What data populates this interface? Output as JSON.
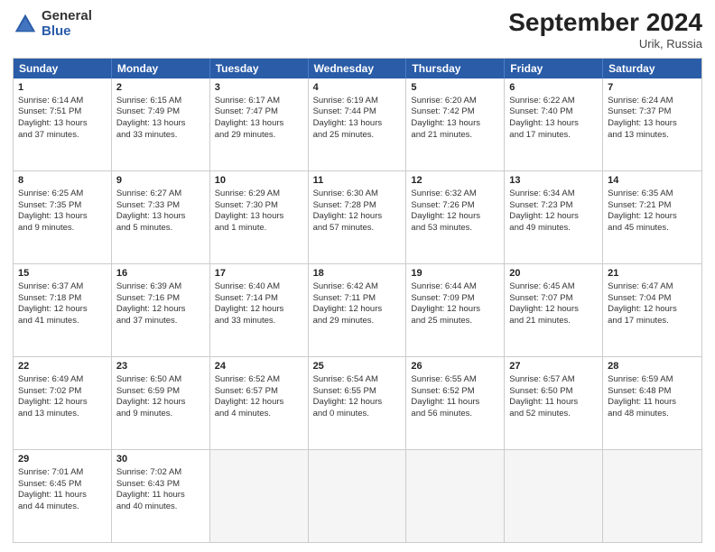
{
  "logo": {
    "general": "General",
    "blue": "Blue"
  },
  "title": "September 2024",
  "location": "Urik, Russia",
  "header_days": [
    "Sunday",
    "Monday",
    "Tuesday",
    "Wednesday",
    "Thursday",
    "Friday",
    "Saturday"
  ],
  "rows": [
    [
      {
        "day": "1",
        "lines": [
          "Sunrise: 6:14 AM",
          "Sunset: 7:51 PM",
          "Daylight: 13 hours",
          "and 37 minutes."
        ]
      },
      {
        "day": "2",
        "lines": [
          "Sunrise: 6:15 AM",
          "Sunset: 7:49 PM",
          "Daylight: 13 hours",
          "and 33 minutes."
        ]
      },
      {
        "day": "3",
        "lines": [
          "Sunrise: 6:17 AM",
          "Sunset: 7:47 PM",
          "Daylight: 13 hours",
          "and 29 minutes."
        ]
      },
      {
        "day": "4",
        "lines": [
          "Sunrise: 6:19 AM",
          "Sunset: 7:44 PM",
          "Daylight: 13 hours",
          "and 25 minutes."
        ]
      },
      {
        "day": "5",
        "lines": [
          "Sunrise: 6:20 AM",
          "Sunset: 7:42 PM",
          "Daylight: 13 hours",
          "and 21 minutes."
        ]
      },
      {
        "day": "6",
        "lines": [
          "Sunrise: 6:22 AM",
          "Sunset: 7:40 PM",
          "Daylight: 13 hours",
          "and 17 minutes."
        ]
      },
      {
        "day": "7",
        "lines": [
          "Sunrise: 6:24 AM",
          "Sunset: 7:37 PM",
          "Daylight: 13 hours",
          "and 13 minutes."
        ]
      }
    ],
    [
      {
        "day": "8",
        "lines": [
          "Sunrise: 6:25 AM",
          "Sunset: 7:35 PM",
          "Daylight: 13 hours",
          "and 9 minutes."
        ]
      },
      {
        "day": "9",
        "lines": [
          "Sunrise: 6:27 AM",
          "Sunset: 7:33 PM",
          "Daylight: 13 hours",
          "and 5 minutes."
        ]
      },
      {
        "day": "10",
        "lines": [
          "Sunrise: 6:29 AM",
          "Sunset: 7:30 PM",
          "Daylight: 13 hours",
          "and 1 minute."
        ]
      },
      {
        "day": "11",
        "lines": [
          "Sunrise: 6:30 AM",
          "Sunset: 7:28 PM",
          "Daylight: 12 hours",
          "and 57 minutes."
        ]
      },
      {
        "day": "12",
        "lines": [
          "Sunrise: 6:32 AM",
          "Sunset: 7:26 PM",
          "Daylight: 12 hours",
          "and 53 minutes."
        ]
      },
      {
        "day": "13",
        "lines": [
          "Sunrise: 6:34 AM",
          "Sunset: 7:23 PM",
          "Daylight: 12 hours",
          "and 49 minutes."
        ]
      },
      {
        "day": "14",
        "lines": [
          "Sunrise: 6:35 AM",
          "Sunset: 7:21 PM",
          "Daylight: 12 hours",
          "and 45 minutes."
        ]
      }
    ],
    [
      {
        "day": "15",
        "lines": [
          "Sunrise: 6:37 AM",
          "Sunset: 7:18 PM",
          "Daylight: 12 hours",
          "and 41 minutes."
        ]
      },
      {
        "day": "16",
        "lines": [
          "Sunrise: 6:39 AM",
          "Sunset: 7:16 PM",
          "Daylight: 12 hours",
          "and 37 minutes."
        ]
      },
      {
        "day": "17",
        "lines": [
          "Sunrise: 6:40 AM",
          "Sunset: 7:14 PM",
          "Daylight: 12 hours",
          "and 33 minutes."
        ]
      },
      {
        "day": "18",
        "lines": [
          "Sunrise: 6:42 AM",
          "Sunset: 7:11 PM",
          "Daylight: 12 hours",
          "and 29 minutes."
        ]
      },
      {
        "day": "19",
        "lines": [
          "Sunrise: 6:44 AM",
          "Sunset: 7:09 PM",
          "Daylight: 12 hours",
          "and 25 minutes."
        ]
      },
      {
        "day": "20",
        "lines": [
          "Sunrise: 6:45 AM",
          "Sunset: 7:07 PM",
          "Daylight: 12 hours",
          "and 21 minutes."
        ]
      },
      {
        "day": "21",
        "lines": [
          "Sunrise: 6:47 AM",
          "Sunset: 7:04 PM",
          "Daylight: 12 hours",
          "and 17 minutes."
        ]
      }
    ],
    [
      {
        "day": "22",
        "lines": [
          "Sunrise: 6:49 AM",
          "Sunset: 7:02 PM",
          "Daylight: 12 hours",
          "and 13 minutes."
        ]
      },
      {
        "day": "23",
        "lines": [
          "Sunrise: 6:50 AM",
          "Sunset: 6:59 PM",
          "Daylight: 12 hours",
          "and 9 minutes."
        ]
      },
      {
        "day": "24",
        "lines": [
          "Sunrise: 6:52 AM",
          "Sunset: 6:57 PM",
          "Daylight: 12 hours",
          "and 4 minutes."
        ]
      },
      {
        "day": "25",
        "lines": [
          "Sunrise: 6:54 AM",
          "Sunset: 6:55 PM",
          "Daylight: 12 hours",
          "and 0 minutes."
        ]
      },
      {
        "day": "26",
        "lines": [
          "Sunrise: 6:55 AM",
          "Sunset: 6:52 PM",
          "Daylight: 11 hours",
          "and 56 minutes."
        ]
      },
      {
        "day": "27",
        "lines": [
          "Sunrise: 6:57 AM",
          "Sunset: 6:50 PM",
          "Daylight: 11 hours",
          "and 52 minutes."
        ]
      },
      {
        "day": "28",
        "lines": [
          "Sunrise: 6:59 AM",
          "Sunset: 6:48 PM",
          "Daylight: 11 hours",
          "and 48 minutes."
        ]
      }
    ],
    [
      {
        "day": "29",
        "lines": [
          "Sunrise: 7:01 AM",
          "Sunset: 6:45 PM",
          "Daylight: 11 hours",
          "and 44 minutes."
        ]
      },
      {
        "day": "30",
        "lines": [
          "Sunrise: 7:02 AM",
          "Sunset: 6:43 PM",
          "Daylight: 11 hours",
          "and 40 minutes."
        ]
      },
      {
        "day": "",
        "lines": []
      },
      {
        "day": "",
        "lines": []
      },
      {
        "day": "",
        "lines": []
      },
      {
        "day": "",
        "lines": []
      },
      {
        "day": "",
        "lines": []
      }
    ]
  ]
}
